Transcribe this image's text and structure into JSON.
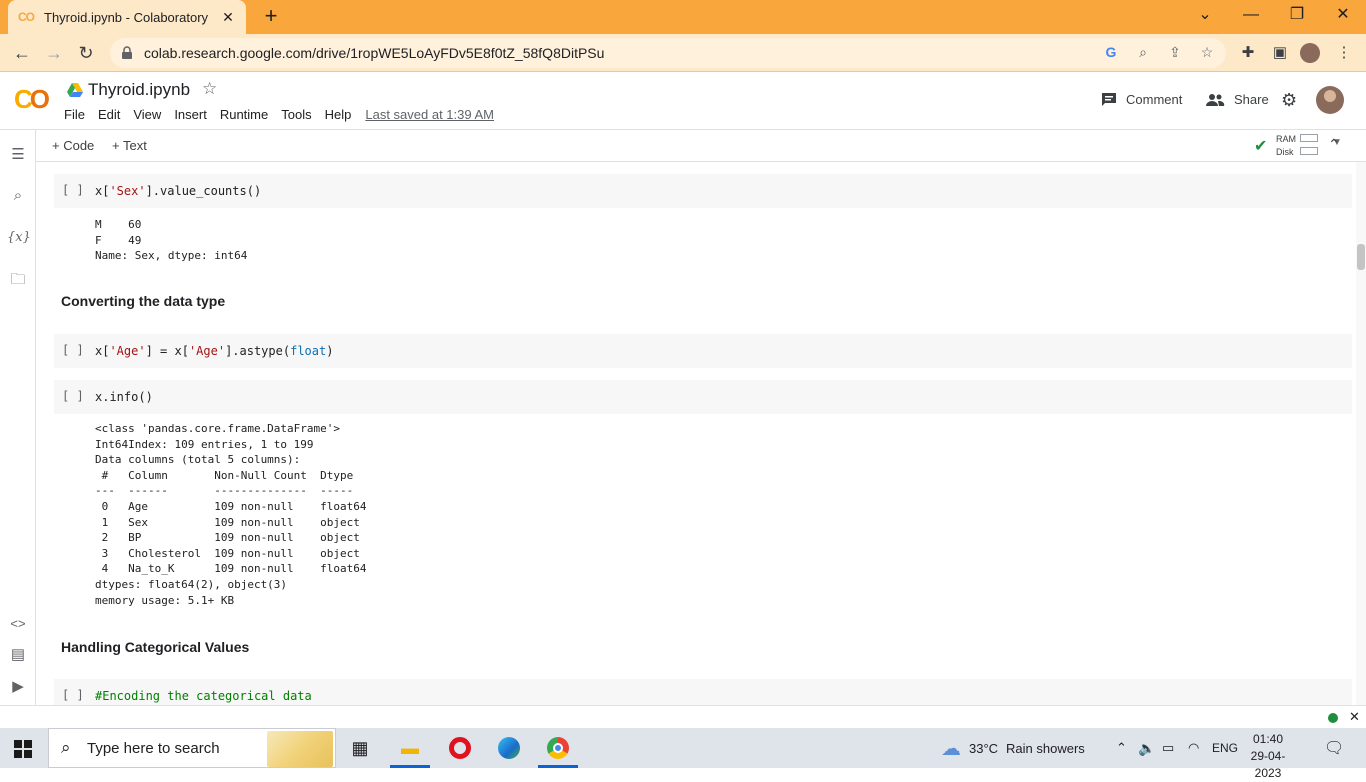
{
  "browser": {
    "tab_title": "Thyroid.ipynb - Colaboratory",
    "tab_favicon": "CO",
    "new_tab": "+",
    "url": "colab.research.google.com/drive/1ropWE5LoAyFDv5E8f0tZ_58fQ8DitPSu",
    "accent": "#f9a63c"
  },
  "colab": {
    "notebook_title": "Thyroid.ipynb",
    "menu": [
      "File",
      "Edit",
      "View",
      "Insert",
      "Runtime",
      "Tools",
      "Help"
    ],
    "last_saved": "Last saved at 1:39 AM",
    "comment_label": "Comment",
    "share_label": "Share",
    "add_code": "+ Code",
    "add_text": "+ Text",
    "ram_label": "RAM",
    "disk_label": "Disk"
  },
  "cells": {
    "c1": {
      "run": "[ ]",
      "src_a": "x[",
      "src_str": "'Sex'",
      "src_b": "].value_counts()",
      "output": "M    60\nF    49\nName: Sex, dtype: int64"
    },
    "h1": "Converting the data type",
    "c2": {
      "run": "[ ]",
      "src_a": "x[",
      "src_str1": "'Age'",
      "src_b": "] = x[",
      "src_str2": "'Age'",
      "src_c": "].astype(",
      "src_kw": "float",
      "src_d": ")"
    },
    "c3": {
      "run": "[ ]",
      "src": "x.info()",
      "output": "<class 'pandas.core.frame.DataFrame'>\nInt64Index: 109 entries, 1 to 199\nData columns (total 5 columns):\n #   Column       Non-Null Count  Dtype  \n---  ------       --------------  -----  \n 0   Age          109 non-null    float64\n 1   Sex          109 non-null    object \n 2   BP           109 non-null    object \n 3   Cholesterol  109 non-null    object \n 4   Na_to_K      109 non-null    float64\ndtypes: float64(2), object(3)\nmemory usage: 5.1+ KB"
    },
    "h2": "Handling Categorical Values",
    "c4": {
      "run": "[ ]",
      "src": "#Encoding the categorical data"
    }
  },
  "taskbar": {
    "search_placeholder": "Type here to search",
    "weather_temp": "33°C",
    "weather_desc": "Rain showers",
    "language": "ENG",
    "time": "01:40",
    "date": "29-04-2023"
  }
}
